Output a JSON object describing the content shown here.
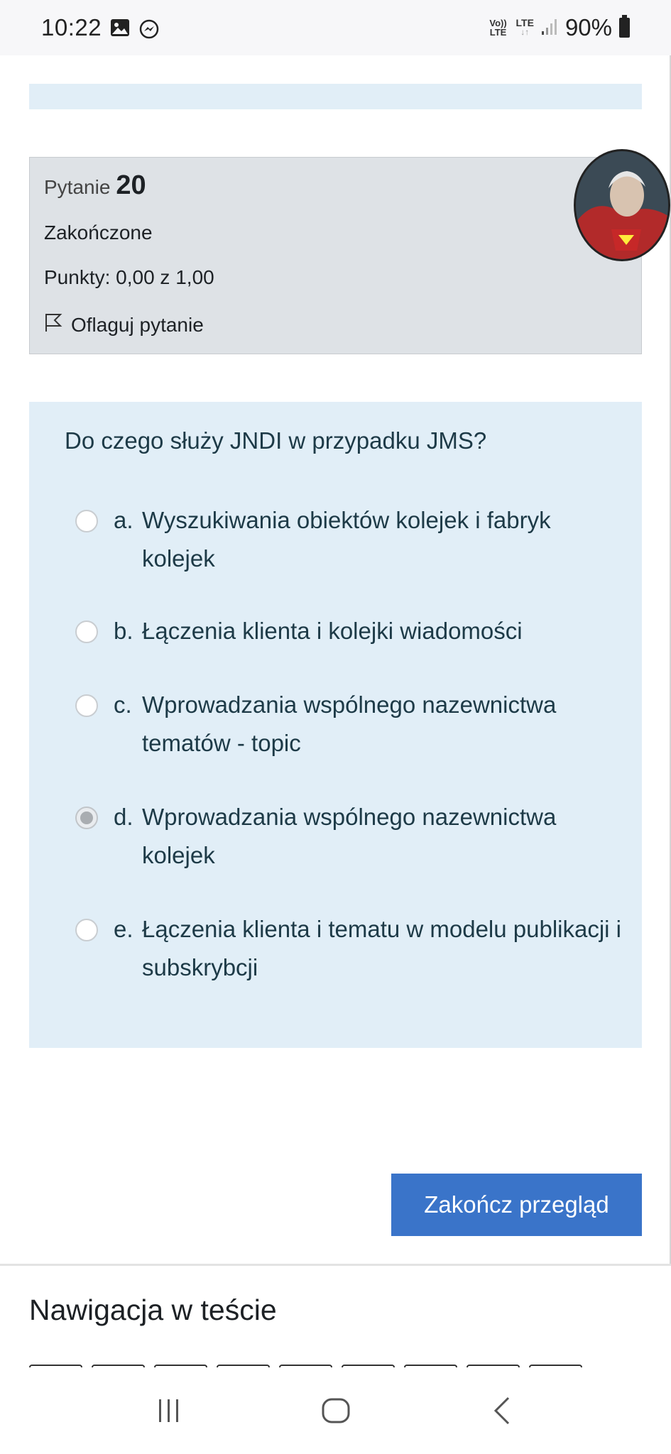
{
  "status_bar": {
    "time": "10:22",
    "volte": "Vo)) LTE",
    "network": "LTE",
    "battery": "90%"
  },
  "question_info": {
    "label": "Pytanie",
    "number": "20",
    "state": "Zakończone",
    "points": "Punkty: 0,00 z 1,00",
    "flag_label": "Oflaguj pytanie"
  },
  "question": {
    "text": "Do czego służy JNDI w przypadku JMS?",
    "answers": [
      {
        "letter": "a.",
        "text": "Wyszukiwania obiektów kolejek i fabryk kolejek",
        "selected": false
      },
      {
        "letter": "b.",
        "text": "Łączenia klienta i kolejki wiadomości",
        "selected": false
      },
      {
        "letter": "c.",
        "text": "Wprowadzania wspólnego nazewnictwa tematów - topic",
        "selected": false
      },
      {
        "letter": "d.",
        "text": "Wprowadzania wspólnego nazewnictwa kolejek",
        "selected": true
      },
      {
        "letter": "e.",
        "text": "Łączenia klienta i tematu w modelu publikacji i subskrybcji",
        "selected": false
      }
    ]
  },
  "finish_button": "Zakończ przegląd",
  "navigation_title": "Nawigacja w teście",
  "colors": {
    "accent": "#3a74c9",
    "question_bg": "#e1eef7",
    "info_bg": "#dee2e6"
  }
}
